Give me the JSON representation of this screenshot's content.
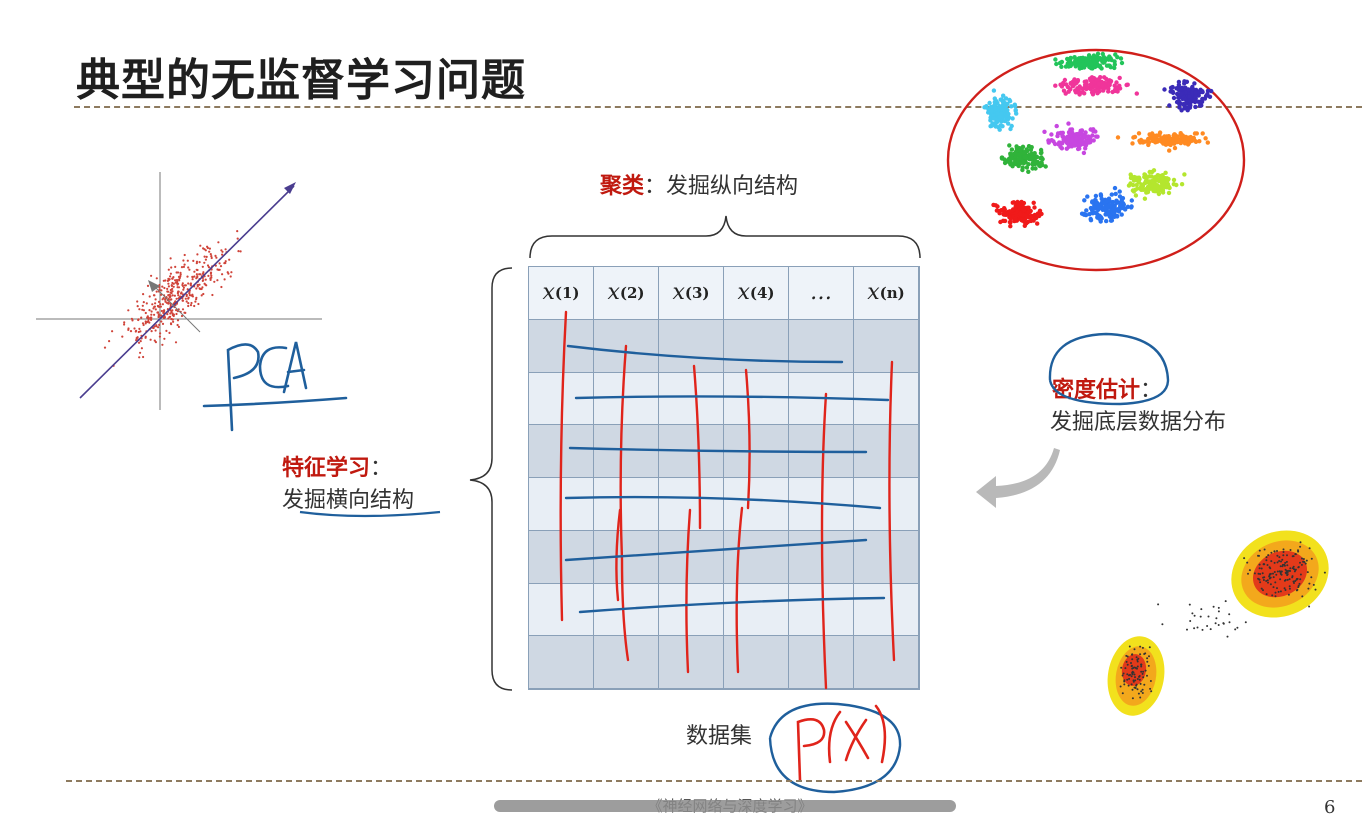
{
  "slide": {
    "title": "典型的无监督学习问题",
    "page_number": "6",
    "footer": "《神经网络与深度学习》"
  },
  "labels": {
    "clustering_term": "聚类",
    "clustering_desc": "：发掘纵向结构",
    "feature_term": "特征学习",
    "feature_colon": "：",
    "feature_desc": "发掘横向结构",
    "density_term": "密度估计",
    "density_colon": "：",
    "density_desc": "发掘底层数据分布",
    "dataset": "数据集"
  },
  "table": {
    "headers": [
      {
        "base": "x",
        "sup": "(1)"
      },
      {
        "base": "x",
        "sup": "(2)"
      },
      {
        "base": "x",
        "sup": "(3)"
      },
      {
        "base": "x",
        "sup": "(4)"
      },
      {
        "base": "…",
        "sup": ""
      },
      {
        "base": "x",
        "sup": "(n)"
      }
    ],
    "body_rows": 7
  },
  "handwriting": {
    "pca": "PCA",
    "px": "P(X)"
  },
  "colors": {
    "accent_red": "#c0190f",
    "ink_blue": "#1f5f9c",
    "ink_red": "#e0241b",
    "grid_dark": "#cfd8e3",
    "grid_light": "#e8eef5"
  }
}
